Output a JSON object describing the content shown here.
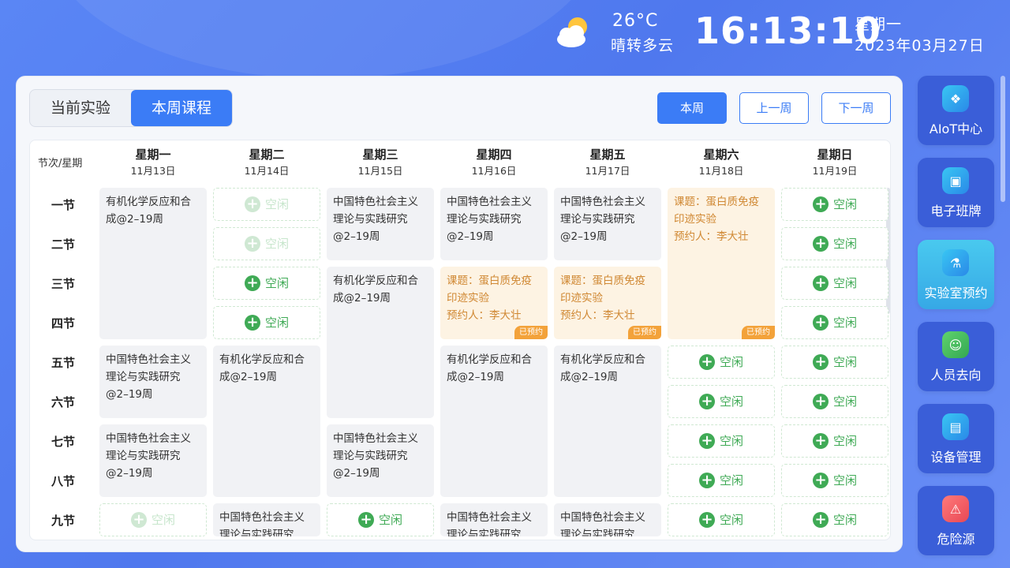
{
  "header": {
    "temperature": "26°C",
    "weather": "晴转多云",
    "time": "16:13:10",
    "weekday": "星期一",
    "date": "2023年03月27日"
  },
  "tabs": [
    "当前实验",
    "本周课程"
  ],
  "week_buttons": {
    "this": "本周",
    "prev": "上一周",
    "next": "下一周"
  },
  "table": {
    "corner": "节次/星期",
    "days": [
      {
        "name": "星期一",
        "date": "11月13日"
      },
      {
        "name": "星期二",
        "date": "11月14日"
      },
      {
        "name": "星期三",
        "date": "11月15日"
      },
      {
        "name": "星期四",
        "date": "11月16日"
      },
      {
        "name": "星期五",
        "date": "11月17日"
      },
      {
        "name": "星期六",
        "date": "11月18日"
      },
      {
        "name": "星期日",
        "date": "11月19日"
      }
    ],
    "periods": [
      "一节",
      "二节",
      "三节",
      "四节",
      "五节",
      "六节",
      "七节",
      "八节",
      "九节"
    ],
    "free_label": "空闲",
    "plus": "+",
    "courses": {
      "organic": "有机化学反应和合成@2–19周",
      "socialism": "中国特色社会主义理论与实践研究@2–19周"
    },
    "appointment": {
      "topic": "课题：蛋白质免疫印迹实验",
      "person": "预约人：李大壮",
      "stamp": "已预约"
    }
  },
  "sidebar": [
    {
      "label": "AIoT中心",
      "icon": "cube-icon"
    },
    {
      "label": "电子班牌",
      "icon": "monitor-icon"
    },
    {
      "label": "实验室预约",
      "icon": "flask-icon"
    },
    {
      "label": "人员去向",
      "icon": "person-icon"
    },
    {
      "label": "设备管理",
      "icon": "device-icon"
    },
    {
      "label": "危险源",
      "icon": "warning-icon"
    }
  ],
  "colors": {
    "accent": "#3b7cf6",
    "free_green": "#3faa55",
    "appointment_orange": "#d08833",
    "course_bg": "#f1f2f5"
  }
}
